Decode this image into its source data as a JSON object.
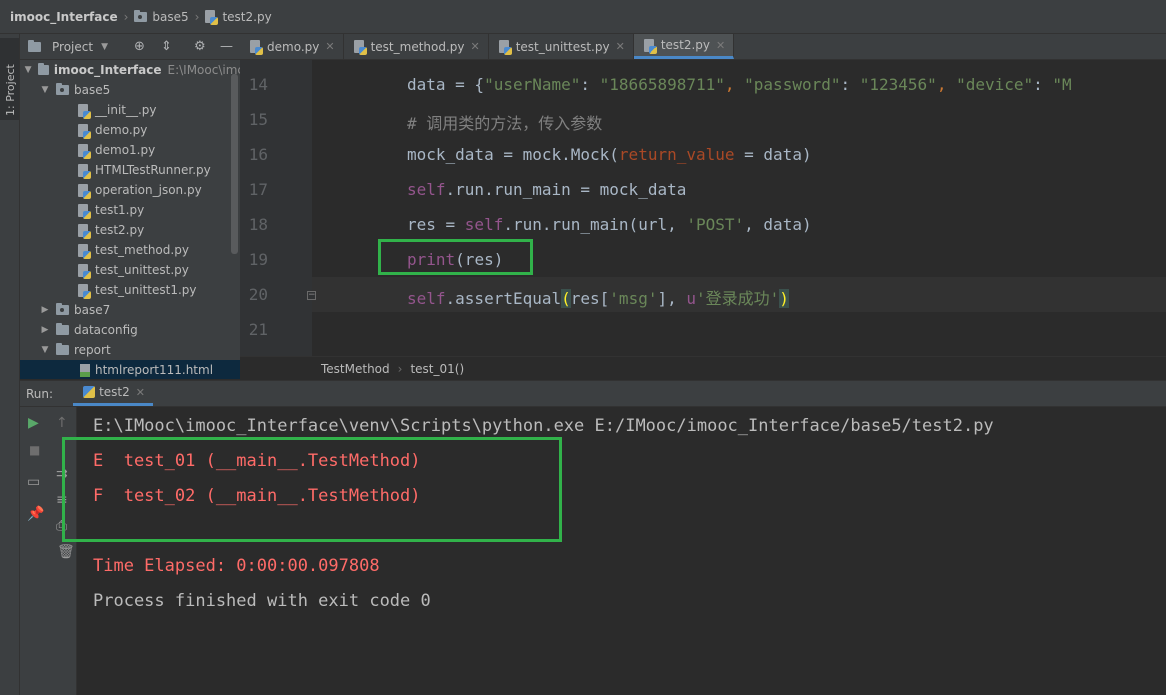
{
  "breadcrumb": {
    "project": "imooc_Interface",
    "folder": "base5",
    "file": "test2.py"
  },
  "left_strip": {
    "project_tab": "1: Project"
  },
  "project_panel": {
    "title": "Project",
    "root": {
      "name": "imooc_Interface",
      "path": "E:\\IMooc\\imc"
    },
    "items": [
      {
        "label": "base5",
        "type": "package",
        "expanded": true
      },
      {
        "label": "__init__.py",
        "type": "python"
      },
      {
        "label": "demo.py",
        "type": "python"
      },
      {
        "label": "demo1.py",
        "type": "python"
      },
      {
        "label": "HTMLTestRunner.py",
        "type": "python"
      },
      {
        "label": "operation_json.py",
        "type": "python"
      },
      {
        "label": "test1.py",
        "type": "python"
      },
      {
        "label": "test2.py",
        "type": "python"
      },
      {
        "label": "test_method.py",
        "type": "python"
      },
      {
        "label": "test_unittest.py",
        "type": "python"
      },
      {
        "label": "test_unittest1.py",
        "type": "python"
      },
      {
        "label": "base7",
        "type": "package",
        "expanded": false
      },
      {
        "label": "dataconfig",
        "type": "folder",
        "expanded": false
      },
      {
        "label": "report",
        "type": "folder",
        "expanded": true
      },
      {
        "label": "htmlreport111.html",
        "type": "html",
        "selected": true
      }
    ]
  },
  "editor_tabs": [
    {
      "label": "demo.py",
      "active": false
    },
    {
      "label": "test_method.py",
      "active": false
    },
    {
      "label": "test_unittest.py",
      "active": false
    },
    {
      "label": "test2.py",
      "active": true
    }
  ],
  "editor": {
    "line_numbers": [
      "14",
      "15",
      "16",
      "17",
      "18",
      "19",
      "20",
      "21"
    ],
    "lines": {
      "l14": {
        "a": "data = {",
        "s1": "\"userName\"",
        "b": ": ",
        "s2": "\"18665898711\"",
        "c": ", ",
        "s3": "\"password\"",
        "d": ": ",
        "s4": "\"123456\"",
        "e": ", ",
        "s5": "\"device\"",
        "f": ": ",
        "s6": "\"M"
      },
      "l15": "# 调用类的方法，传入参数",
      "l16": {
        "a": "mock_data = mock.Mock(",
        "param": "return_value",
        "b": " = data)"
      },
      "l17": {
        "self": "self",
        "b": ".run.run_main = mock_data"
      },
      "l18": {
        "a": "res = ",
        "self": "self",
        "b": ".run.run_main(url, ",
        "s": "'POST'",
        "c": ", data)"
      },
      "l19": {
        "fn": "print",
        "b": "(res)"
      },
      "l20": {
        "self": "self",
        "a": ".assertEqual",
        "p1": "(",
        "b": "res[",
        "s1": "'msg'",
        "c": "], ",
        "u": "u",
        "s2": "'登录成功'",
        "p2": ")"
      }
    }
  },
  "editor_breadcrumb": [
    "TestMethod",
    "test_01()"
  ],
  "run_panel": {
    "label": "Run:",
    "tab": "test2",
    "console": {
      "cmd": "E:\\IMooc\\imooc_Interface\\venv\\Scripts\\python.exe E:/IMooc/imooc_Interface/base5/test2.py",
      "err1": "E  test_01 (__main__.TestMethod)",
      "err2": "F  test_02 (__main__.TestMethod)",
      "time": "Time Elapsed: 0:00:00.097808",
      "exit": "Process finished with exit code 0"
    }
  },
  "colors": {
    "highlight_box": "#31b24a",
    "error_text": "#ff6b68",
    "keyword_self": "#94558d",
    "string": "#6a8759",
    "comment": "#808080"
  }
}
